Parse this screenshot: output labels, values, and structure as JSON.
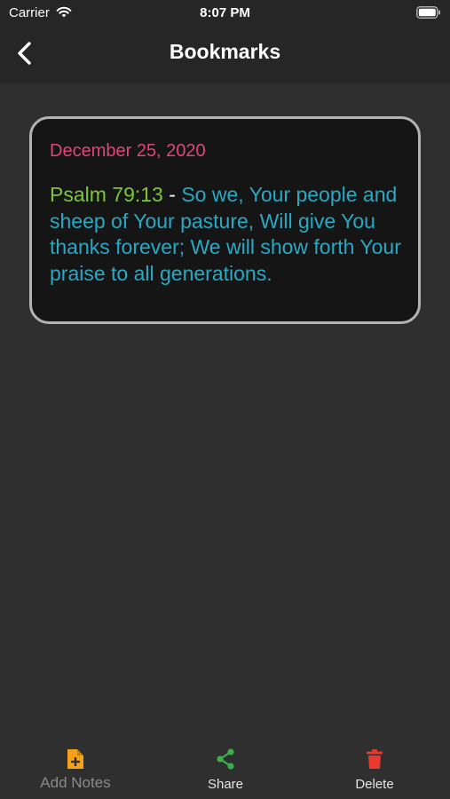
{
  "status": {
    "carrier": "Carrier",
    "time": "8:07 PM"
  },
  "nav": {
    "title": "Bookmarks",
    "back_icon": "chevron-left-icon"
  },
  "bookmark": {
    "date": "December 25, 2020",
    "reference": "Psalm 79:13",
    "separator": " - ",
    "text": "So we, Your people and sheep of Your pasture, Will give You thanks forever; We will show forth Your praise to all generations."
  },
  "toolbar": {
    "add_notes_label": "Add Notes",
    "share_label": "Share",
    "delete_label": "Delete"
  },
  "colors": {
    "date": "#e0457a",
    "reference": "#7ac63a",
    "verse": "#27a9c4",
    "add_notes": "#f4a21a",
    "share": "#3bb04a",
    "delete": "#e8392f"
  }
}
